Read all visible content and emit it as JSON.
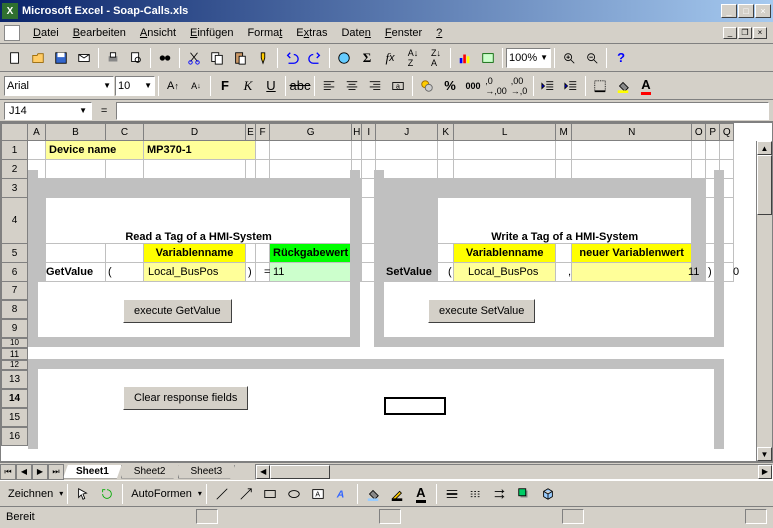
{
  "app": {
    "title": "Microsoft Excel - Soap-Calls.xls"
  },
  "menu": {
    "items": [
      "Datei",
      "Bearbeiten",
      "Ansicht",
      "Einfügen",
      "Format",
      "Extras",
      "Daten",
      "Fenster",
      "?"
    ]
  },
  "formatting_bar": {
    "font_name": "Arial",
    "font_size": "10",
    "zoom": "100%"
  },
  "formula_bar": {
    "cell_ref": "J14",
    "formula": ""
  },
  "columns": [
    "A",
    "B",
    "C",
    "D",
    "E",
    "F",
    "G",
    "H",
    "I",
    "J",
    "K",
    "L",
    "M",
    "N",
    "O",
    "P",
    "Q"
  ],
  "rows": [
    "1",
    "2",
    "3",
    "4",
    "5",
    "6",
    "7",
    "8",
    "9",
    "10",
    "11",
    "12",
    "13",
    "14",
    "15",
    "16"
  ],
  "cells": {
    "b1_label": "Device name",
    "d1_value": "MP370-1",
    "read_title": "Read a Tag of a HMI-System",
    "write_title": "Write a Tag of a HMI-System",
    "var_name_hdr": "Variablenname",
    "return_val_hdr": "Rückgabewert",
    "new_val_hdr": "neuer Variablenwert",
    "getvalue_label": "GetValue",
    "setvalue_label": "SetValue",
    "open_paren": "(",
    "close_paren": ")",
    "comma": ",",
    "equals": "=",
    "read_var": "Local_BusPos",
    "write_var": "Local_BusPos",
    "return_value": "11",
    "write_value": "11",
    "zero": "0",
    "btn_get": "execute GetValue",
    "btn_set": "execute SetValue",
    "btn_clear": "Clear response fields"
  },
  "sheets": {
    "tabs": [
      "Sheet1",
      "Sheet2",
      "Sheet3"
    ],
    "active": 0
  },
  "drawing_bar": {
    "label": "Zeichnen",
    "autoshapes": "AutoFormen"
  },
  "status": {
    "text": "Bereit"
  }
}
